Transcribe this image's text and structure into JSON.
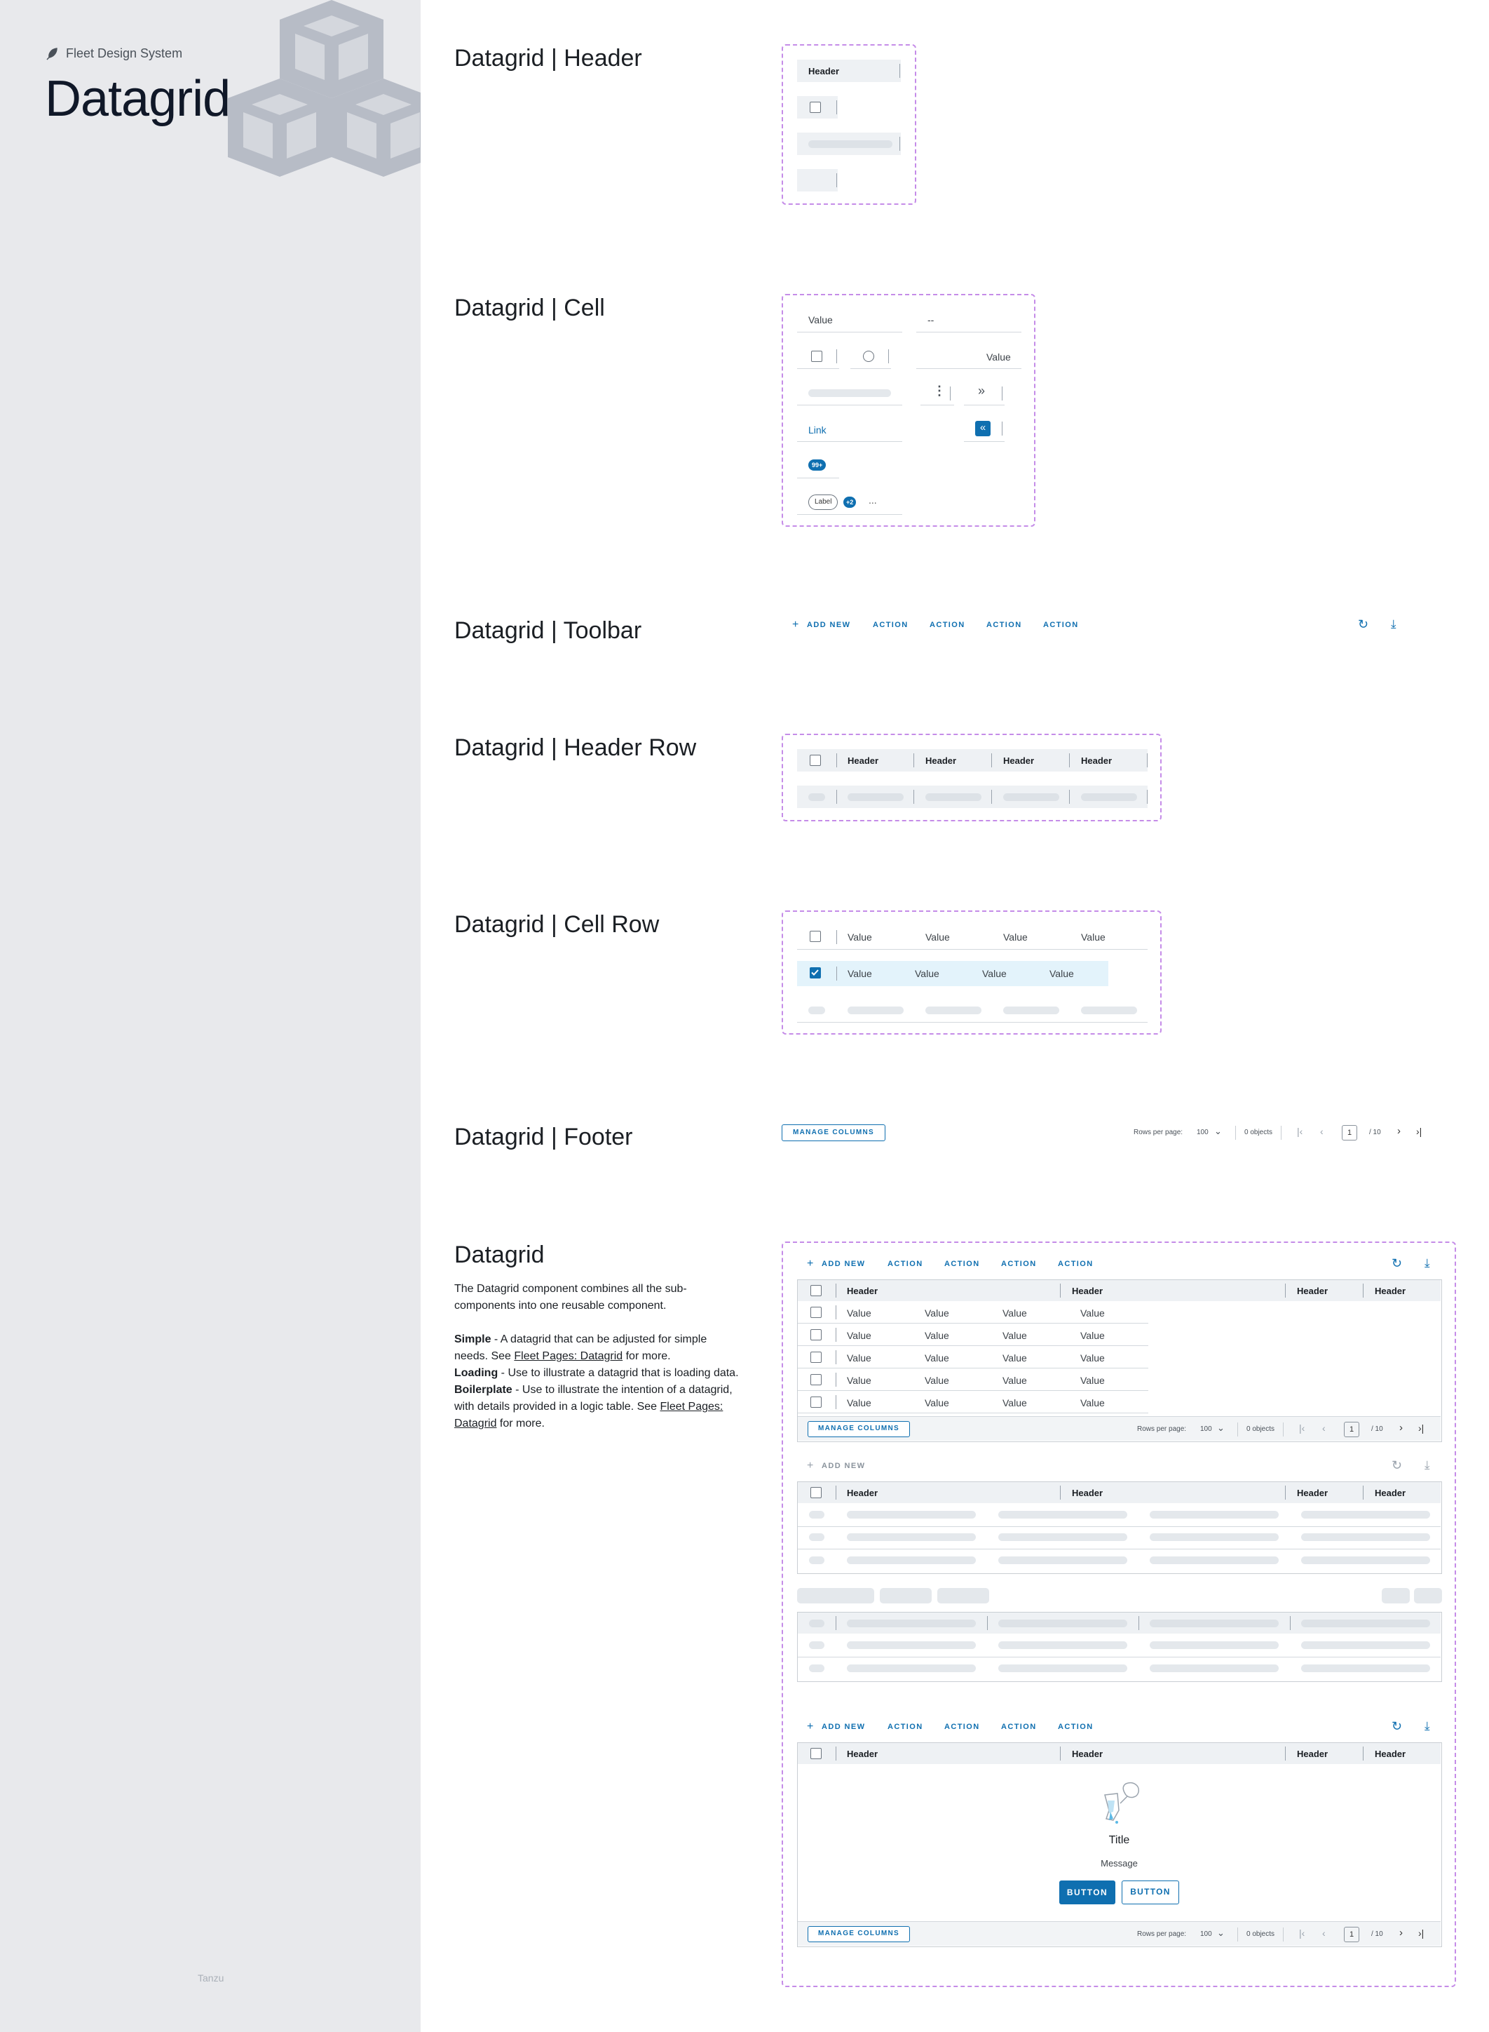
{
  "sidebar": {
    "brand": "Fleet Design System",
    "title": "Datagrid",
    "footer": "Tanzu"
  },
  "sections": {
    "header": "Datagrid | Header",
    "cell": "Datagrid | Cell",
    "toolbar": "Datagrid | Toolbar",
    "header_row": "Datagrid | Header Row",
    "cell_row": "Datagrid | Cell Row",
    "footer": "Datagrid | Footer",
    "datagrid": "Datagrid"
  },
  "header_demo": {
    "label": "Header"
  },
  "cell_demo": {
    "value": "Value",
    "dash": "--",
    "value_right": "Value",
    "link": "Link",
    "badge": "99+",
    "label": "Label",
    "count": "+2",
    "more": "..."
  },
  "toolbar": {
    "add_new": "ADD NEW",
    "action": "ACTION"
  },
  "header_row": {
    "headers": [
      "Header",
      "Header",
      "Header",
      "Header"
    ]
  },
  "cell_row": {
    "value": "Value"
  },
  "footer": {
    "manage_columns": "MANAGE COLUMNS",
    "rows_per_page": "Rows per page:",
    "rows_value": "100",
    "objects": "0 objects",
    "page": "1",
    "total": "/ 10"
  },
  "description": {
    "intro": "The Datagrid component combines all the sub-components into one reusable component.",
    "simple_label": "Simple",
    "simple_text": " - A datagrid that can be adjusted for simple needs. See ",
    "link": "Fleet Pages: Datagrid",
    "simple_end": " for more.",
    "loading_label": "Loading",
    "loading_text": " - Use to illustrate a datagrid that is loading data.",
    "boilerplate_label": "Boilerplate",
    "boilerplate_text": " - Use to illustrate the intention of a datagrid, with details provided in a logic table. See ",
    "boilerplate_end": " for more."
  },
  "empty_state": {
    "title": "Title",
    "message": "Message",
    "button": "BUTTON"
  },
  "colors": {
    "accent": "#0f6fb0",
    "dashed": "#c58ce8",
    "sidebar": "#e8e9ec"
  }
}
